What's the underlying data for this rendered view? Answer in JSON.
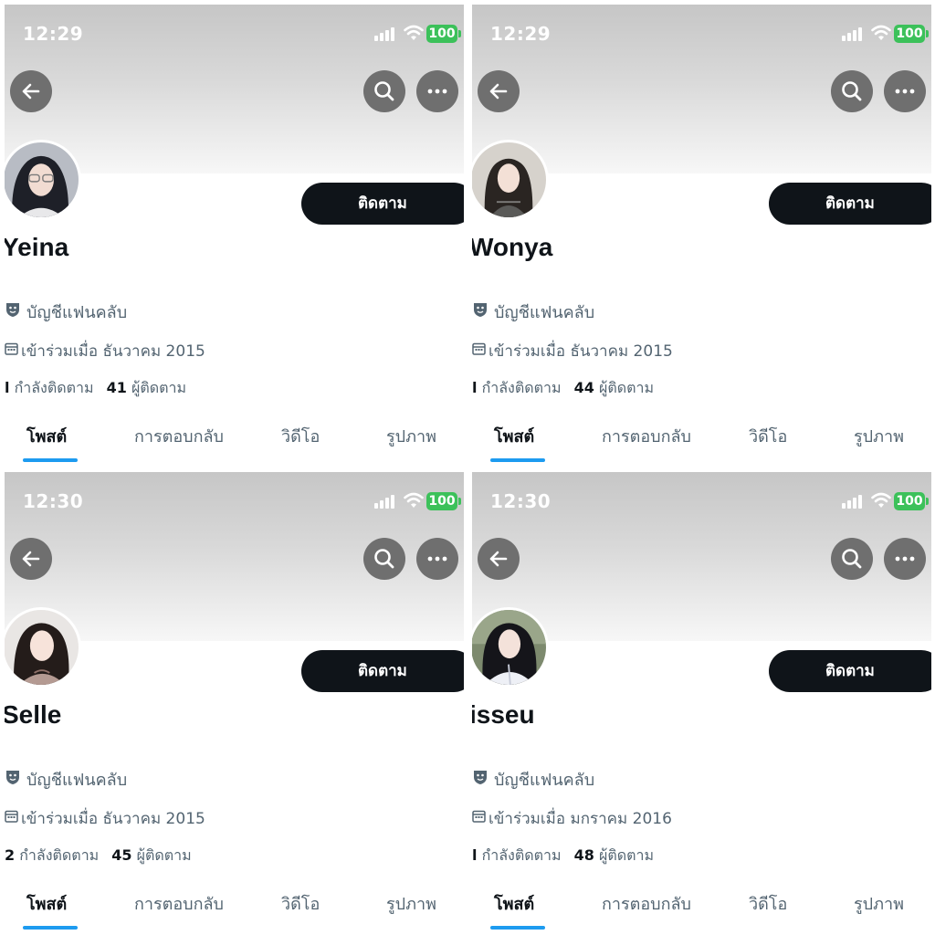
{
  "common": {
    "follow_label": "ติดตาม",
    "fan_account_label": "บัญชีแฟนคลับ",
    "following_suffix": "กำลังติดตาม",
    "followers_suffix": "ผู้ติดตาม",
    "battery_level": "100",
    "tabs": [
      "โพสต์",
      "การตอบกลับ",
      "วิดีโอ",
      "รูปภาพ"
    ],
    "active_tab": "โพสต์",
    "accent_color": "#1d9bf0",
    "battery_color": "#3cc15a",
    "icons": [
      "back-arrow-icon",
      "search-icon",
      "more-icon",
      "fan-mask-icon",
      "calendar-icon",
      "signal-icon",
      "wifi-icon",
      "battery-icon"
    ]
  },
  "profiles": [
    {
      "time": "12:29",
      "name": "Yeina",
      "joined": "เข้าร่วมเมื่อ ธันวาคม 2015",
      "following_count": "l",
      "followers_count": "41"
    },
    {
      "time": "12:29",
      "name": "Wonya",
      "joined": "เข้าร่วมเมื่อ ธันวาคม 2015",
      "following_count": "l",
      "followers_count": "44"
    },
    {
      "time": "12:30",
      "name": "Selle",
      "joined": "เข้าร่วมเมื่อ ธันวาคม 2015",
      "following_count": "2",
      "followers_count": "45"
    },
    {
      "time": "12:30",
      "name": "isseu",
      "joined": "เข้าร่วมเมื่อ มกราคม 2016",
      "following_count": "l",
      "followers_count": "48"
    }
  ]
}
